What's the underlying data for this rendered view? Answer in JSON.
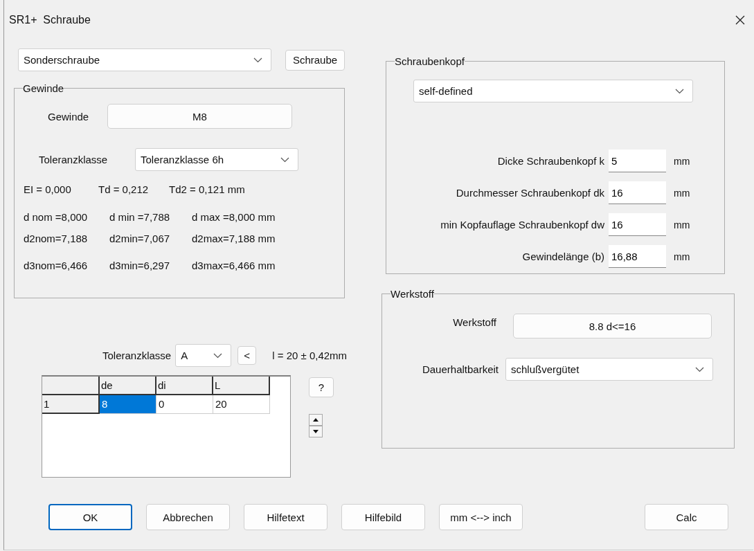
{
  "window": {
    "title": "SR1+  Schraube"
  },
  "screw_type": {
    "value": "Sonderschraube"
  },
  "screw_button": "Schraube",
  "thread_group": {
    "title": "Gewinde",
    "thread_label": "Gewinde",
    "thread_value": "M8",
    "tolerance_label": "Toleranzklasse",
    "tolerance_value": "Toleranzklasse 6h",
    "results": [
      [
        "EI = 0,000",
        "Td = 0,212",
        "Td2 = 0,121 mm"
      ],
      [
        "d nom =8,000",
        "d min =7,788",
        "d max =8,000 mm"
      ],
      [
        "d2nom=7,188",
        "d2min=7,067",
        "d2max=7,188 mm"
      ],
      [
        "d3nom=6,466",
        "d3min=6,297",
        "d3max=6,466 mm"
      ]
    ]
  },
  "length_tolerance": {
    "label": "Toleranzklasse",
    "value": "A",
    "back_button": "<",
    "result": "l = 20 ± 0,42mm"
  },
  "table": {
    "columns": [
      "de",
      "di",
      "L"
    ],
    "rows": [
      {
        "header": "1",
        "cells": [
          {
            "text": "8",
            "selected": true
          },
          {
            "text": "0",
            "selected": false
          },
          {
            "text": "20",
            "selected": false
          }
        ]
      }
    ]
  },
  "help_button": "?",
  "head_group": {
    "title": "Schraubenkopf",
    "type": "self-defined",
    "fields": [
      {
        "label": "Dicke Schraubenkopf k",
        "value": "5",
        "unit": "mm"
      },
      {
        "label": "Durchmesser Schraubenkopf dk",
        "value": "16",
        "unit": "mm"
      },
      {
        "label": "min Kopfauflage Schraubenkopf dw",
        "value": "16",
        "unit": "mm"
      },
      {
        "label": "Gewindelänge (b)",
        "value": "16,88",
        "unit": "mm"
      }
    ]
  },
  "material_group": {
    "title": "Werkstoff",
    "material_label": "Werkstoff",
    "material_value": "8.8 d<=16",
    "durability_label": "Dauerhaltbarkeit",
    "durability_value": "schlußvergütet"
  },
  "buttons": [
    {
      "label": "OK",
      "default": true
    },
    {
      "label": "Abbrechen",
      "default": false
    },
    {
      "label": "Hilfetext",
      "default": false
    },
    {
      "label": "Hilfebild",
      "default": false
    },
    {
      "label": "mm <--> inch",
      "default": false
    },
    {
      "label": "Calc",
      "default": false
    }
  ]
}
